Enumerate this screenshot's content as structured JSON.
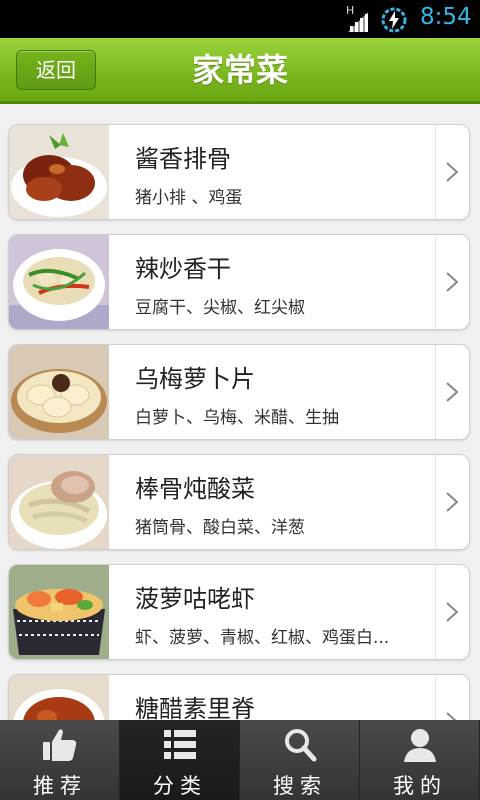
{
  "status_bar": {
    "network": "H",
    "time": "8:54"
  },
  "header": {
    "back_label": "返回",
    "title": "家常菜"
  },
  "recipes": [
    {
      "name": "酱香排骨",
      "ingredients": "猪小排 、鸡蛋"
    },
    {
      "name": "辣炒香干",
      "ingredients": "豆腐干、尖椒、红尖椒"
    },
    {
      "name": "乌梅萝卜片",
      "ingredients": "白萝卜、乌梅、米醋、生抽"
    },
    {
      "name": "棒骨炖酸菜",
      "ingredients": "猪筒骨、酸白菜、洋葱"
    },
    {
      "name": "菠萝咕咾虾",
      "ingredients": "虾、菠萝、青椒、红椒、鸡蛋白..."
    },
    {
      "name": "糖醋素里脊",
      "ingredients": ""
    }
  ],
  "bottom_nav": [
    {
      "label": "推荐",
      "icon": "thumbs-up-icon"
    },
    {
      "label": "分类",
      "icon": "list-icon",
      "active": true
    },
    {
      "label": "搜索",
      "icon": "search-icon"
    },
    {
      "label": "我的",
      "icon": "person-icon"
    }
  ],
  "colors": {
    "header_green": "#7cb81f",
    "nav_bg": "#3a3a3a",
    "status_blue": "#33b5e5"
  }
}
